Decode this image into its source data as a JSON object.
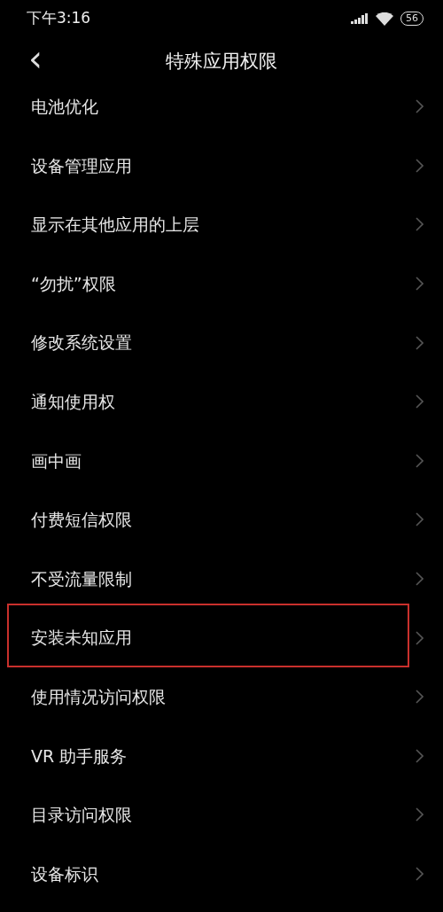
{
  "status_bar": {
    "time": "下午3:16",
    "battery": "56"
  },
  "header": {
    "back": "‹",
    "title": "特殊应用权限"
  },
  "items": [
    {
      "label": "电池优化",
      "highlighted": false
    },
    {
      "label": "设备管理应用",
      "highlighted": false
    },
    {
      "label": "显示在其他应用的上层",
      "highlighted": false
    },
    {
      "label": "“勿扰”权限",
      "highlighted": false
    },
    {
      "label": "修改系统设置",
      "highlighted": false
    },
    {
      "label": "通知使用权",
      "highlighted": false
    },
    {
      "label": "画中画",
      "highlighted": false
    },
    {
      "label": "付费短信权限",
      "highlighted": false
    },
    {
      "label": "不受流量限制",
      "highlighted": false
    },
    {
      "label": "安装未知应用",
      "highlighted": true
    },
    {
      "label": "使用情况访问权限",
      "highlighted": false
    },
    {
      "label": "VR 助手服务",
      "highlighted": false
    },
    {
      "label": "目录访问权限",
      "highlighted": false
    },
    {
      "label": "设备标识",
      "highlighted": false
    }
  ]
}
